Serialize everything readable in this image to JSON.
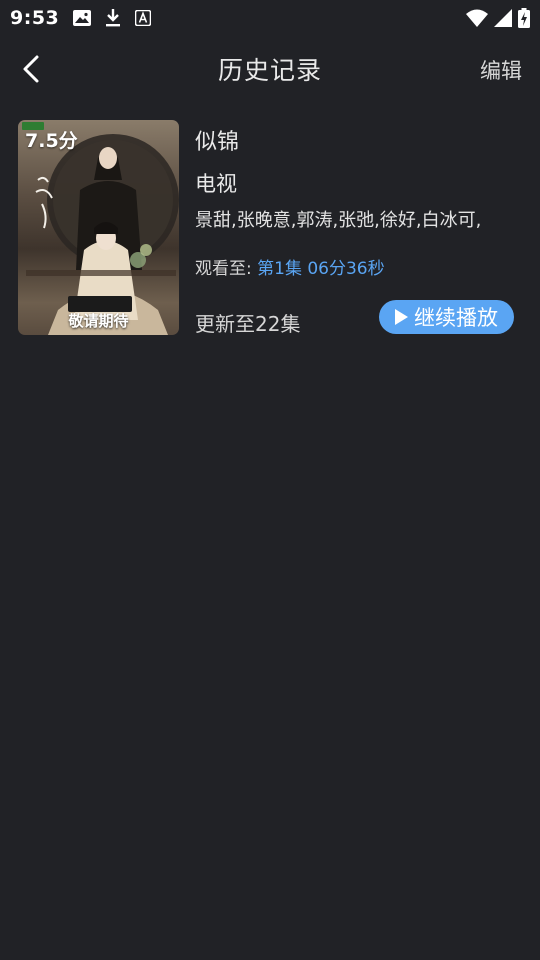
{
  "status_bar": {
    "time": "9:53",
    "left_icons": [
      "image-icon",
      "download-icon",
      "font-a-icon"
    ],
    "right_icons": [
      "wifi-icon",
      "signal-icon",
      "battery-charging-icon"
    ]
  },
  "app_bar": {
    "back_icon": "chevron-left-icon",
    "title": "历史记录",
    "edit_label": "编辑"
  },
  "history": {
    "items": [
      {
        "poster": {
          "rating": "7.5分",
          "caption": "敬请期待"
        },
        "title": "似锦",
        "type": "电视",
        "cast": "景甜,张晚意,郭涛,张弛,徐好,白冰可,",
        "watched_label": "观看至:",
        "watched_progress": "第1集 06分36秒",
        "updated": "更新至22集",
        "continue_label": "继续播放",
        "continue_icon": "play-icon"
      }
    ]
  },
  "colors": {
    "background": "#212226",
    "accent": "#5aa5f3",
    "text_primary": "#e9e9e9"
  }
}
